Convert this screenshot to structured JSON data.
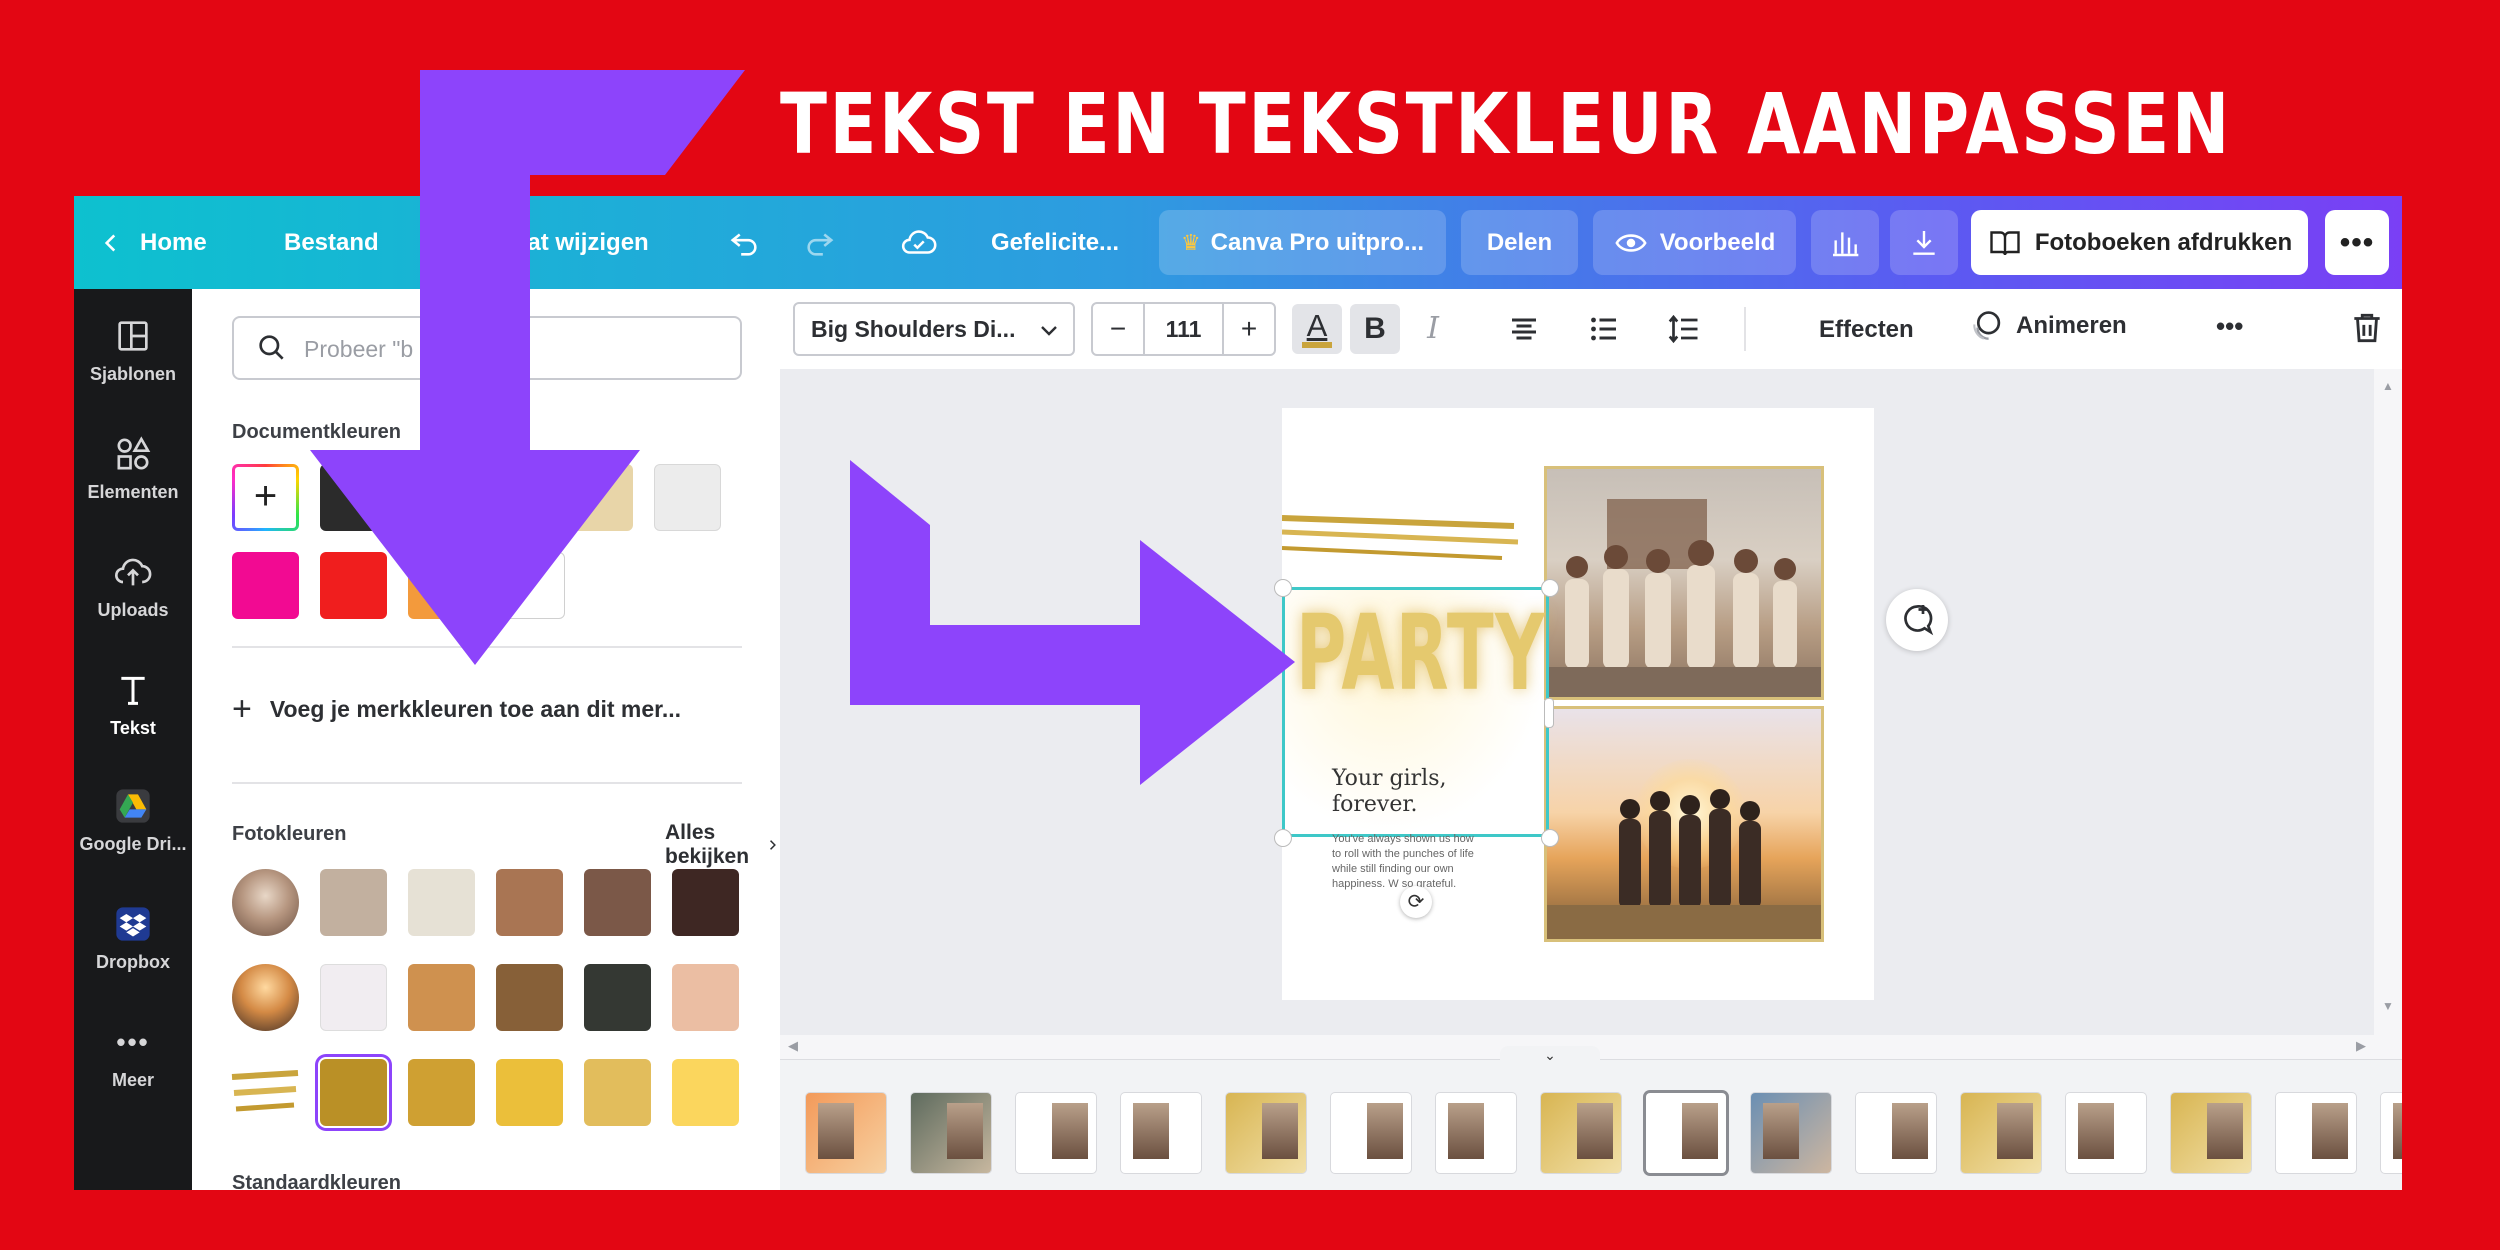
{
  "headline": "TEKST EN TEKSTKLEUR AANPASSEN",
  "topbar": {
    "home": "Home",
    "file": "Bestand",
    "resize": "aat wijzigen",
    "doc_title": "Gefelicite...",
    "pro": "Canva Pro uitpro...",
    "share": "Delen",
    "preview": "Voorbeeld",
    "print": "Fotoboeken afdrukken"
  },
  "rail": [
    {
      "label": "Sjablonen",
      "icon": "templates-icon"
    },
    {
      "label": "Elementen",
      "icon": "elements-icon"
    },
    {
      "label": "Uploads",
      "icon": "upload-icon"
    },
    {
      "label": "Tekst",
      "icon": "text-icon"
    },
    {
      "label": "Google Dri...",
      "icon": "google-drive-icon"
    },
    {
      "label": "Dropbox",
      "icon": "dropbox-icon"
    },
    {
      "label": "Meer",
      "icon": "more-icon"
    }
  ],
  "panel": {
    "search_placeholder": "Probeer \"b         00c4cc\"",
    "document_colors": "Documentkleuren",
    "add_brand": "Voeg je merkkleuren toe aan dit mer...",
    "photo_colors": "Fotokleuren",
    "see_all": "Alles bekijken",
    "standard_colors": "Standaardkleuren",
    "doc_swatches": [
      "#2b2b2b",
      "#e8d5a8",
      "#ececec",
      "#f20a92",
      "#f01e1e",
      "#f39a3c",
      "#ffffff"
    ],
    "photo_rows": [
      [
        "#c2b09f",
        "#e6e1d5",
        "#a97553",
        "#7b5848",
        "#3e2723"
      ],
      [
        "#f1edf1",
        "#cf914f",
        "#876038",
        "#343833",
        "#ebbea3"
      ],
      [
        "#ba9026",
        "#cfa032",
        "#ebbf3a",
        "#e2bd5c",
        "#fbd65d"
      ]
    ]
  },
  "toolbar": {
    "font": "Big Shoulders Di...",
    "minus": "−",
    "size": "111",
    "plus": "+",
    "text_color_letter": "A",
    "bold": "B",
    "italic": "I",
    "effects": "Effecten",
    "animate": "Animeren"
  },
  "page": {
    "title": "PARTY",
    "subtitle_line1": "Your girls,",
    "subtitle_line2": "forever.",
    "body1": "You've always shown us how",
    "body2": "to roll with the punches of life",
    "body3": "while still finding our own",
    "body4": "happiness. W    so grateful."
  },
  "colors": {
    "accent_purple": "#8d44fb",
    "background_red": "#e30613",
    "selection": "#3ec8c8"
  }
}
